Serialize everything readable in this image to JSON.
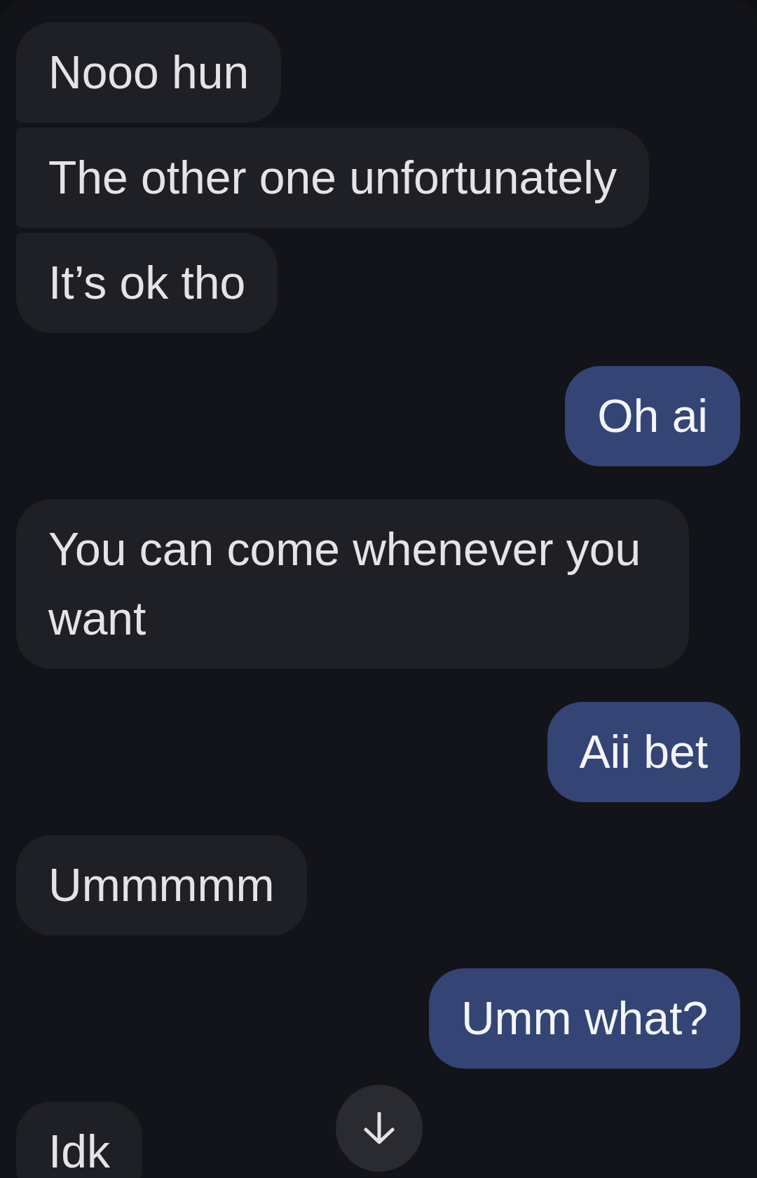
{
  "messages": [
    {
      "kind": "received",
      "text": "Nooo hun"
    },
    {
      "kind": "received",
      "text": "The other one unfortunately"
    },
    {
      "kind": "received",
      "text": "It’s ok tho"
    },
    {
      "kind": "sent",
      "text": "Oh ai"
    },
    {
      "kind": "received",
      "text": "You can come whenever you want"
    },
    {
      "kind": "sent",
      "text": "Aii bet"
    },
    {
      "kind": "received",
      "text": "Ummmmm"
    },
    {
      "kind": "sent",
      "text": "Umm what?"
    },
    {
      "kind": "received",
      "text": "Idk"
    }
  ]
}
